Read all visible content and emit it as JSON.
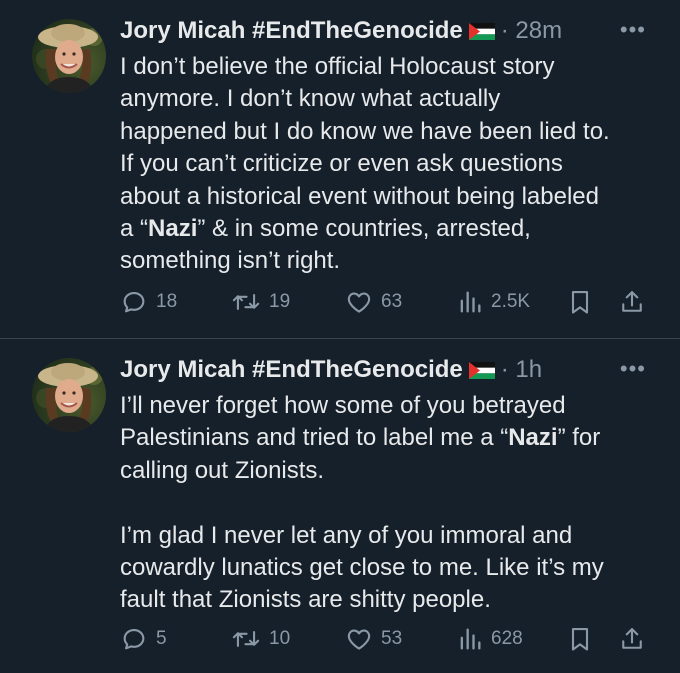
{
  "tweets": [
    {
      "author": "Jory Micah #EndTheGenocide",
      "time": "· 28m",
      "more": "•••",
      "lines": [
        [
          {
            "t": "I don’t believe the official Holocaust story"
          }
        ],
        [
          {
            "t": "anymore. I don’t know what actually"
          }
        ],
        [
          {
            "t": "happened but I do know we have been lied to."
          }
        ],
        [
          {
            "t": "If you can’t criticize or even ask questions"
          }
        ],
        [
          {
            "t": "about a historical event without being labeled"
          }
        ],
        [
          {
            "t": "a “"
          },
          {
            "t": "Nazi",
            "b": true
          },
          {
            "t": "” & in some countries, arrested,"
          }
        ],
        [
          {
            "t": "something isn’t right."
          }
        ]
      ],
      "stats": {
        "replies": "18",
        "reposts": "19",
        "likes": "63",
        "views": "2.5K"
      }
    },
    {
      "author": "Jory Micah #EndTheGenocide",
      "time": "· 1h",
      "more": "•••",
      "lines": [
        [
          {
            "t": "I’ll never forget how some of you betrayed"
          }
        ],
        [
          {
            "t": "Palestinians and tried to label me a “"
          },
          {
            "t": "Nazi",
            "b": true
          },
          {
            "t": "” for"
          }
        ],
        [
          {
            "t": "calling out Zionists."
          }
        ],
        [],
        [
          {
            "t": "I’m glad I never let any of you immoral and"
          }
        ],
        [
          {
            "t": "cowardly lunatics get close to me. Like it’s my"
          }
        ],
        [
          {
            "t": "fault that Zionists are shitty people."
          }
        ]
      ],
      "stats": {
        "replies": "5",
        "reposts": "10",
        "likes": "53",
        "views": "628"
      }
    }
  ],
  "icons": {
    "avatar": "profile-photo",
    "flag": "palestine-flag",
    "reply": "reply-icon",
    "repost": "repost-icon",
    "like": "heart-icon",
    "views": "views-icon",
    "bookmark": "bookmark-icon",
    "share": "share-icon"
  },
  "colors": {
    "background": "#15202b",
    "text": "#e7e9ea",
    "muted": "#8b98a5",
    "divider": "#38444d"
  }
}
